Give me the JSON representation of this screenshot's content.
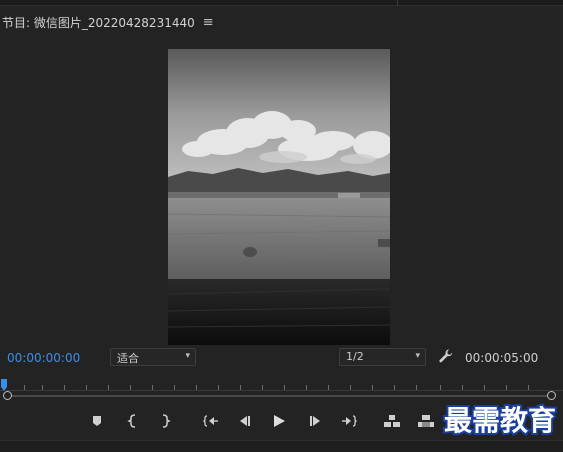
{
  "panel": {
    "title": "节目: 微信图片_20220428231440",
    "menu_icon": "hamburger-menu-icon"
  },
  "timecode": {
    "current": "00:00:00:00",
    "duration": "00:00:05:00",
    "current_color": "#3a8ee6"
  },
  "zoom_select": {
    "value": "适合"
  },
  "resolution_select": {
    "value": "1/2"
  },
  "settings_icon": "wrench-icon",
  "transport": [
    {
      "name": "add-marker-icon"
    },
    {
      "name": "mark-in-icon"
    },
    {
      "name": "mark-out-icon"
    },
    {
      "name": "go-to-in-icon"
    },
    {
      "name": "step-back-icon"
    },
    {
      "name": "play-icon"
    },
    {
      "name": "step-forward-icon"
    },
    {
      "name": "go-to-out-icon"
    },
    {
      "name": "insert-icon"
    },
    {
      "name": "overwrite-icon"
    }
  ],
  "watermark": {
    "text": "最需教育"
  }
}
